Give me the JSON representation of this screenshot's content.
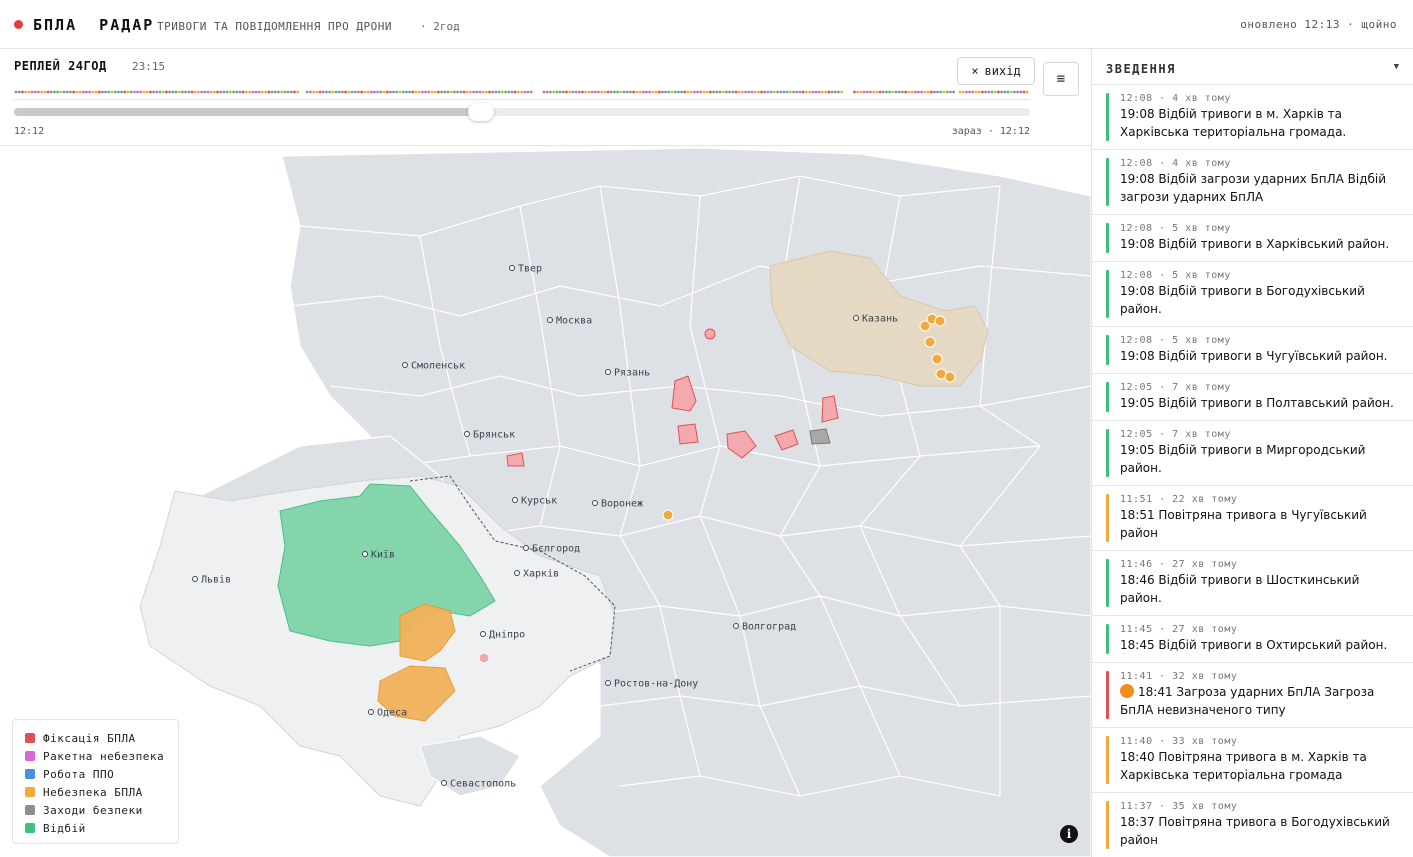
{
  "header": {
    "brand": "БПЛА  РАДАР",
    "subtitle": "ТРИВОГИ ТА ПОВІДОМЛЕННЯ ПРО ДРОНИ",
    "window": "· 2год",
    "updated": "оновлено 12:13 · щойно"
  },
  "replay": {
    "title": "РЕПЛЕЙ 24ГОД",
    "current_time": "23:15",
    "exit_label": "вихід",
    "range_start": "12:12",
    "range_end": "зараз · 12:12",
    "position": 0.46,
    "menu_icon": "hamburger-icon"
  },
  "colors": {
    "drone_detection": "#e05252",
    "missile": "#d966d6",
    "air_defense": "#4a90d9",
    "drone_danger": "#f2a93b",
    "security": "#8e8e8e",
    "all_clear": "#3fbf7f",
    "map_region": "#dde0e4",
    "map_ukraine": "#eef0f2"
  },
  "map": {
    "cities": [
      {
        "name": "Твер"
      },
      {
        "name": "Москва"
      },
      {
        "name": "Смоленськ"
      },
      {
        "name": "Рязань"
      },
      {
        "name": "Казань"
      },
      {
        "name": "Брянськ"
      },
      {
        "name": "Курськ"
      },
      {
        "name": "Воронеж"
      },
      {
        "name": "Бєлгород"
      },
      {
        "name": "Київ"
      },
      {
        "name": "Харків"
      },
      {
        "name": "Львів"
      },
      {
        "name": "Дніпро"
      },
      {
        "name": "Волгоград"
      },
      {
        "name": "Ростов-на-Дону"
      },
      {
        "name": "Одеса"
      },
      {
        "name": "Севастополь"
      }
    ]
  },
  "legend": {
    "items": [
      {
        "label": "Фіксація БПЛА",
        "color": "#e05252"
      },
      {
        "label": "Ракетна небезпека",
        "color": "#d966d6"
      },
      {
        "label": "Робота ППО",
        "color": "#4a90d9"
      },
      {
        "label": "Небезпека БПЛА",
        "color": "#f2a93b"
      },
      {
        "label": "Заходи безпеки",
        "color": "#8e8e8e"
      },
      {
        "label": "Відбій",
        "color": "#3fbf7f"
      }
    ]
  },
  "sidebar": {
    "title": "ЗВЕДЕННЯ",
    "caret": "▼",
    "items": [
      {
        "meta": "12:08 · 4 хв тому",
        "text": "19:08 Відбій тривоги в м. Харків та Харківська територіальна громада.",
        "color": "#3fbf7f"
      },
      {
        "meta": "12:08 · 4 хв тому",
        "text": "19:08 Відбій загрози ударних БпЛА Відбій загрози ударних БпЛА",
        "color": "#3fbf7f"
      },
      {
        "meta": "12:08 · 5 хв тому",
        "text": "19:08 Відбій тривоги в Харківський район.",
        "color": "#3fbf7f"
      },
      {
        "meta": "12:08 · 5 хв тому",
        "text": "19:08 Відбій тривоги в Богодухівський район.",
        "color": "#3fbf7f"
      },
      {
        "meta": "12:08 · 5 хв тому",
        "text": "19:08 Відбій тривоги в Чугуївський район.",
        "color": "#3fbf7f"
      },
      {
        "meta": "12:05 · 7 хв тому",
        "text": "19:05 Відбій тривоги в Полтавський район.",
        "color": "#3fbf7f"
      },
      {
        "meta": "12:05 · 7 хв тому",
        "text": "19:05 Відбій тривоги в Миргородський район.",
        "color": "#3fbf7f"
      },
      {
        "meta": "11:51 · 22 хв тому",
        "text": "18:51 Повітряна тривога в Чугуївський район",
        "color": "#f2a93b"
      },
      {
        "meta": "11:46 · 27 хв тому",
        "text": "18:46 Відбій тривоги в Шосткинський район.",
        "color": "#3fbf7f"
      },
      {
        "meta": "11:45 · 27 хв тому",
        "text": "18:45 Відбій тривоги в Охтирський район.",
        "color": "#3fbf7f"
      },
      {
        "meta": "11:41 · 32 хв тому",
        "text": "18:41 Загроза ударних БпЛА Загроза БпЛА невизначеного типу",
        "color": "#e05252",
        "emoji": true
      },
      {
        "meta": "11:40 · 33 хв тому",
        "text": "18:40 Повітряна тривога в м. Харків та Харківська територіальна громада",
        "color": "#f2a93b"
      },
      {
        "meta": "11:37 · 35 хв тому",
        "text": "18:37 Повітряна тривога в Богодухівський район",
        "color": "#f2a93b"
      }
    ]
  }
}
